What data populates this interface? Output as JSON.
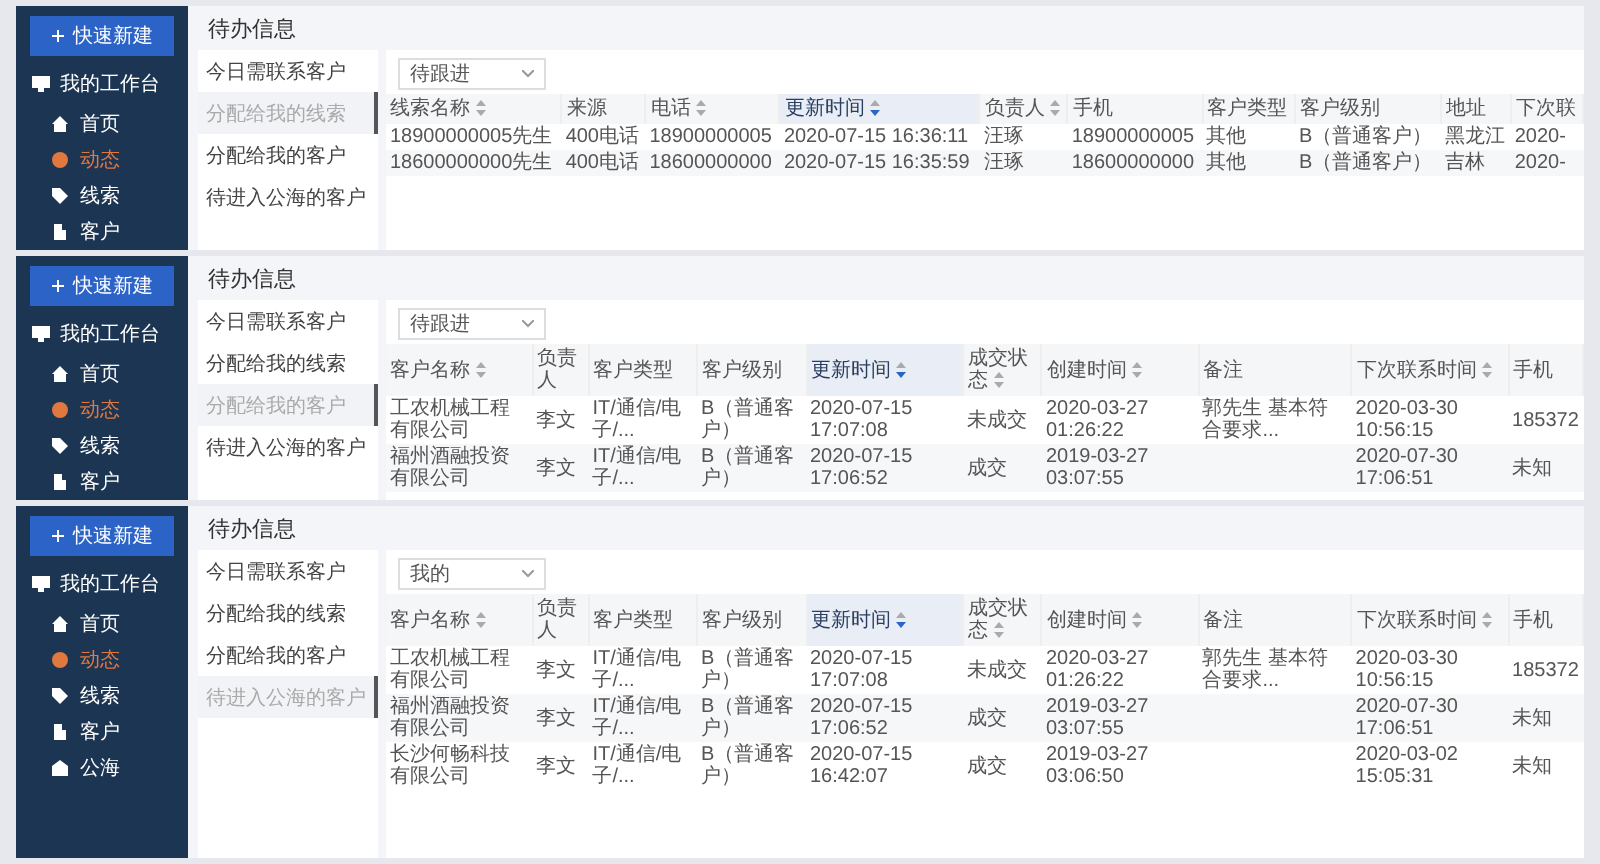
{
  "panels": [
    {
      "sidebar": {
        "new_button": "快速新建",
        "workspace": "我的工作台",
        "items": [
          {
            "label": "首页",
            "selected": false
          },
          {
            "label": "动态",
            "selected": true
          },
          {
            "label": "线索",
            "selected": false
          },
          {
            "label": "客户",
            "selected": false
          }
        ]
      },
      "title": "待办信息",
      "tabs": [
        {
          "label": "今日需联系客户",
          "selected": false
        },
        {
          "label": "分配给我的线索",
          "selected": true
        },
        {
          "label": "分配给我的客户",
          "selected": false
        },
        {
          "label": "待进入公海的客户",
          "selected": false
        }
      ],
      "filter": "待跟进",
      "table": {
        "columns": [
          {
            "label": "线索名称",
            "sortable": true,
            "sorted": false
          },
          {
            "label": "来源",
            "sortable": false,
            "sorted": false
          },
          {
            "label": "电话",
            "sortable": true,
            "sorted": false
          },
          {
            "label": "更新时间",
            "sortable": true,
            "sorted": true
          },
          {
            "label": "负责人",
            "sortable": true,
            "sorted": false
          },
          {
            "label": "手机",
            "sortable": false,
            "sorted": false
          },
          {
            "label": "客户类型",
            "sortable": false,
            "sorted": false
          },
          {
            "label": "客户级别",
            "sortable": false,
            "sorted": false
          },
          {
            "label": "地址",
            "sortable": false,
            "sorted": false
          },
          {
            "label": "下次联",
            "sortable": false,
            "sorted": false
          }
        ],
        "rows": [
          [
            "18900000005先生",
            "400电话",
            "18900000005",
            "2020-07-15 16:36:11",
            "汪琢",
            "18900000005",
            "其他",
            "B（普通客户）",
            "黑龙江",
            "2020-"
          ],
          [
            "18600000000先生",
            "400电话",
            "18600000000",
            "2020-07-15 16:35:59",
            "汪琢",
            "18600000000",
            "其他",
            "B（普通客户）",
            "吉林",
            "2020-"
          ]
        ]
      }
    },
    {
      "sidebar": {
        "new_button": "快速新建",
        "workspace": "我的工作台",
        "items": [
          {
            "label": "首页",
            "selected": false
          },
          {
            "label": "动态",
            "selected": true
          },
          {
            "label": "线索",
            "selected": false
          },
          {
            "label": "客户",
            "selected": false
          }
        ]
      },
      "title": "待办信息",
      "tabs": [
        {
          "label": "今日需联系客户",
          "selected": false
        },
        {
          "label": "分配给我的线索",
          "selected": false
        },
        {
          "label": "分配给我的客户",
          "selected": true
        },
        {
          "label": "待进入公海的客户",
          "selected": false
        }
      ],
      "filter": "待跟进",
      "table": {
        "columns": [
          {
            "label": "客户名称",
            "sortable": true,
            "sorted": false
          },
          {
            "label": "负责人",
            "sortable": false,
            "sorted": false
          },
          {
            "label": "客户类型",
            "sortable": false,
            "sorted": false
          },
          {
            "label": "客户级别",
            "sortable": false,
            "sorted": false
          },
          {
            "label": "更新时间",
            "sortable": true,
            "sorted": true
          },
          {
            "label": "成交状态",
            "sortable": true,
            "sorted": false
          },
          {
            "label": "创建时间",
            "sortable": true,
            "sorted": false
          },
          {
            "label": "备注",
            "sortable": false,
            "sorted": false
          },
          {
            "label": "下次联系时间",
            "sortable": true,
            "sorted": false
          },
          {
            "label": "手机",
            "sortable": false,
            "sorted": false
          }
        ],
        "rows": [
          [
            "工农机械工程有限公司",
            "李文",
            "IT/通信/电子/...",
            "B（普通客户）",
            "2020-07-15 17:07:08",
            "未成交",
            "2020-03-27 01:26:22",
            "郭先生 基本符合要求...",
            "2020-03-30 10:56:15",
            "185372"
          ],
          [
            "福州酒融投资有限公司",
            "李文",
            "IT/通信/电子/...",
            "B（普通客户）",
            "2020-07-15 17:06:52",
            "成交",
            "2019-03-27 03:07:55",
            null,
            "2020-07-30 17:06:51",
            "未知"
          ]
        ]
      }
    },
    {
      "sidebar": {
        "new_button": "快速新建",
        "workspace": "我的工作台",
        "items": [
          {
            "label": "首页",
            "selected": false
          },
          {
            "label": "动态",
            "selected": true
          },
          {
            "label": "线索",
            "selected": false
          },
          {
            "label": "客户",
            "selected": false
          },
          {
            "label": "公海",
            "selected": false
          }
        ]
      },
      "title": "待办信息",
      "tabs": [
        {
          "label": "今日需联系客户",
          "selected": false
        },
        {
          "label": "分配给我的线索",
          "selected": false
        },
        {
          "label": "分配给我的客户",
          "selected": false
        },
        {
          "label": "待进入公海的客户",
          "selected": true
        }
      ],
      "filter": "我的",
      "table": {
        "columns": [
          {
            "label": "客户名称",
            "sortable": true,
            "sorted": false
          },
          {
            "label": "负责人",
            "sortable": false,
            "sorted": false
          },
          {
            "label": "客户类型",
            "sortable": false,
            "sorted": false
          },
          {
            "label": "客户级别",
            "sortable": false,
            "sorted": false
          },
          {
            "label": "更新时间",
            "sortable": true,
            "sorted": true
          },
          {
            "label": "成交状态",
            "sortable": true,
            "sorted": false
          },
          {
            "label": "创建时间",
            "sortable": true,
            "sorted": false
          },
          {
            "label": "备注",
            "sortable": false,
            "sorted": false
          },
          {
            "label": "下次联系时间",
            "sortable": true,
            "sorted": false
          },
          {
            "label": "手机",
            "sortable": false,
            "sorted": false
          }
        ],
        "rows": [
          [
            "工农机械工程有限公司",
            "李文",
            "IT/通信/电子/...",
            "B（普通客户）",
            "2020-07-15 17:07:08",
            "未成交",
            "2020-03-27 01:26:22",
            "郭先生 基本符合要求...",
            "2020-03-30 10:56:15",
            "185372"
          ],
          [
            "福州酒融投资有限公司",
            "李文",
            "IT/通信/电子/...",
            "B（普通客户）",
            "2020-07-15 17:06:52",
            "成交",
            "2019-03-27 03:07:55",
            null,
            "2020-07-30 17:06:51",
            "未知"
          ],
          [
            "长沙何畅科技有限公司",
            "李文",
            "IT/通信/电子/...",
            "B（普通客户）",
            "2020-07-15 16:42:07",
            "成交",
            "2019-03-27 03:06:50",
            null,
            "2020-03-02 15:05:31",
            "未知"
          ]
        ]
      }
    }
  ]
}
